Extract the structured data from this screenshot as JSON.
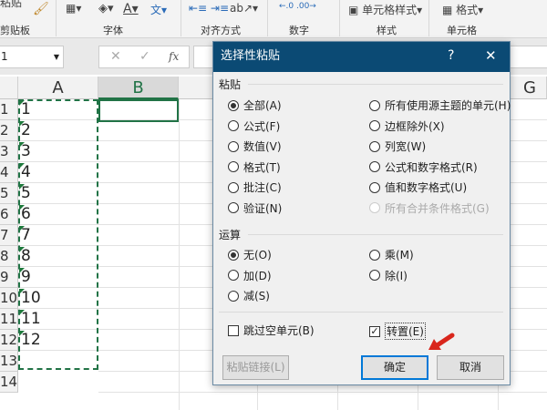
{
  "ribbon": {
    "groups": [
      "剪贴板",
      "字体",
      "对齐方式",
      "数字",
      "样式",
      "单元格"
    ],
    "paste_label": "粘贴",
    "cell_styles": "单元格样式",
    "format": "格式"
  },
  "formula_bar": {
    "name_box": "1",
    "fx": "fx",
    "cancel": "✕",
    "enter": "✓"
  },
  "grid": {
    "columns": [
      "A",
      "B",
      "G"
    ],
    "rows": [
      "1",
      "2",
      "3",
      "4",
      "5",
      "6",
      "7",
      "8",
      "9",
      "10",
      "11",
      "12",
      "13",
      "14"
    ],
    "col_a_values": [
      "1",
      "2",
      "3",
      "4",
      "5",
      "6",
      "7",
      "8",
      "9",
      "10",
      "11",
      "12"
    ]
  },
  "dialog": {
    "title": "选择性粘贴",
    "help": "?",
    "close": "✕",
    "paste_section": "粘贴",
    "paste_left": [
      "全部(A)",
      "公式(F)",
      "数值(V)",
      "格式(T)",
      "批注(C)",
      "验证(N)"
    ],
    "paste_right": [
      "所有使用源主题的单元(H)",
      "边框除外(X)",
      "列宽(W)",
      "公式和数字格式(R)",
      "值和数字格式(U)",
      "所有合并条件格式(G)"
    ],
    "op_section": "运算",
    "op_left": [
      "无(O)",
      "加(D)",
      "减(S)"
    ],
    "op_right": [
      "乘(M)",
      "除(I)"
    ],
    "skip_blanks": "跳过空单元(B)",
    "transpose": "转置(E)",
    "paste_link": "粘贴链接(L)",
    "ok": "确定",
    "cancel": "取消"
  },
  "colors": {
    "title_bar": "#0b4a74",
    "arrow": "#d9261c"
  }
}
